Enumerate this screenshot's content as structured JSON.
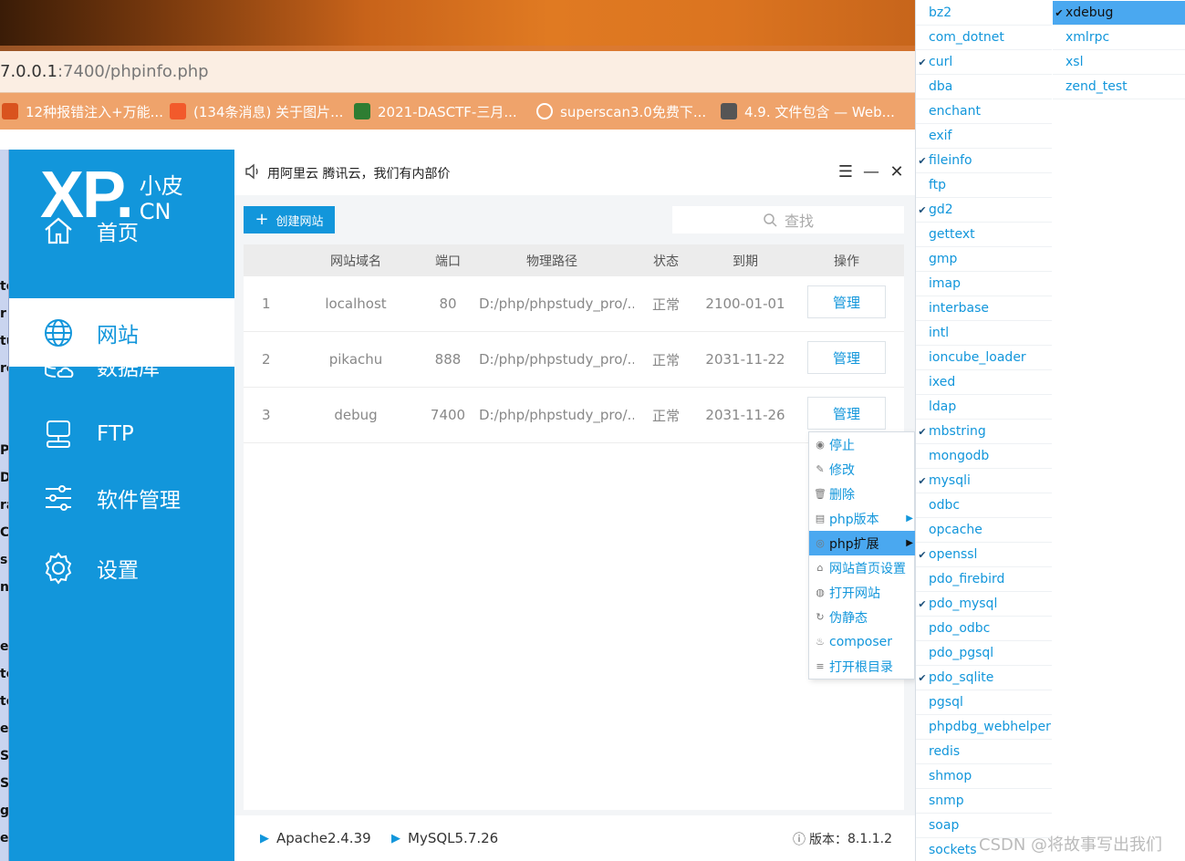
{
  "browser": {
    "address_main": "7.0.0.1",
    "address_rest": ":7400/phpinfo.php",
    "bookmarks": [
      {
        "label": "12种报错注入+万能...",
        "color": "#d9531e"
      },
      {
        "label": "(134条消息) 关于图片...",
        "color": "#f25a2b"
      },
      {
        "label": "2021-DASCTF-三月...",
        "color": "#2e7d32"
      },
      {
        "label": "superscan3.0免费下...",
        "color": "#ffffff"
      },
      {
        "label": "4.9. 文件包含 — Web...",
        "color": "#555555"
      }
    ]
  },
  "left_strip_chars": [
    "te",
    "r",
    "tu",
    "re",
    "P",
    "Di",
    "ra",
    "C",
    "s",
    "na",
    "er",
    "te",
    "te",
    "er",
    "Su",
    "Sa",
    "gn",
    "er"
  ],
  "sidebar": {
    "logo_big": "XP.",
    "logo_small_top": "小皮",
    "logo_small_bottom": "CN",
    "items": [
      {
        "label": "首页",
        "icon": "home-icon"
      },
      {
        "label": "网站",
        "icon": "globe-icon"
      },
      {
        "label": "数据库",
        "icon": "database-icon"
      },
      {
        "label": "FTP",
        "icon": "ftp-server-icon"
      },
      {
        "label": "软件管理",
        "icon": "sliders-icon"
      },
      {
        "label": "设置",
        "icon": "gear-icon"
      }
    ],
    "active_index": 1
  },
  "header": {
    "notice": "用阿里云 腾讯云，我们有内部价",
    "menu_glyph": "☰",
    "minimize_glyph": "—",
    "close_glyph": "✕"
  },
  "toolbar": {
    "create_plus": "+",
    "create_label": "创建网站",
    "search_icon": "search-icon",
    "search_label": "查找"
  },
  "table": {
    "columns": [
      "",
      "网站域名",
      "端口",
      "物理路径",
      "状态",
      "到期",
      "操作"
    ],
    "rows": [
      {
        "index": "1",
        "domain": "localhost",
        "port": "80",
        "path": "D:/php/phpstudy_pro/...",
        "status": "正常",
        "expiry": "2100-01-01",
        "action": "管理"
      },
      {
        "index": "2",
        "domain": "pikachu",
        "port": "888",
        "path": "D:/php/phpstudy_pro/...",
        "status": "正常",
        "expiry": "2031-11-22",
        "action": "管理"
      },
      {
        "index": "3",
        "domain": "debug",
        "port": "7400",
        "path": "D:/php/phpstudy_pro/...",
        "status": "正常",
        "expiry": "2031-11-26",
        "action": "管理"
      }
    ]
  },
  "context_menu": [
    {
      "label": "停止",
      "icon": "stop-icon",
      "glyph": "◉"
    },
    {
      "label": "修改",
      "icon": "pencil-icon",
      "glyph": "✎"
    },
    {
      "label": "删除",
      "icon": "trash-icon",
      "glyph": "🗑"
    },
    {
      "label": "php版本",
      "icon": "php-version-icon",
      "glyph": "▤",
      "submenu": true
    },
    {
      "label": "php扩展",
      "icon": "php-extension-icon",
      "glyph": "◎",
      "submenu": true,
      "highlighted": true
    },
    {
      "label": "网站首页设置",
      "icon": "home-small-icon",
      "glyph": "⌂"
    },
    {
      "label": "打开网站",
      "icon": "globe-small-icon",
      "glyph": "◍"
    },
    {
      "label": "伪静态",
      "icon": "refresh-icon",
      "glyph": "↻"
    },
    {
      "label": "composer",
      "icon": "composer-icon",
      "glyph": "♨"
    },
    {
      "label": "打开根目录",
      "icon": "list-icon",
      "glyph": "≡"
    }
  ],
  "extensions_col1": [
    {
      "name": "bz2",
      "checked": false
    },
    {
      "name": "com_dotnet",
      "checked": false
    },
    {
      "name": "curl",
      "checked": true
    },
    {
      "name": "dba",
      "checked": false
    },
    {
      "name": "enchant",
      "checked": false
    },
    {
      "name": "exif",
      "checked": false
    },
    {
      "name": "fileinfo",
      "checked": true
    },
    {
      "name": "ftp",
      "checked": false
    },
    {
      "name": "gd2",
      "checked": true
    },
    {
      "name": "gettext",
      "checked": false
    },
    {
      "name": "gmp",
      "checked": false
    },
    {
      "name": "imap",
      "checked": false
    },
    {
      "name": "interbase",
      "checked": false
    },
    {
      "name": "intl",
      "checked": false
    },
    {
      "name": "ioncube_loader",
      "checked": false
    },
    {
      "name": "ixed",
      "checked": false
    },
    {
      "name": "ldap",
      "checked": false
    },
    {
      "name": "mbstring",
      "checked": true
    },
    {
      "name": "mongodb",
      "checked": false
    },
    {
      "name": "mysqli",
      "checked": true
    },
    {
      "name": "odbc",
      "checked": false
    },
    {
      "name": "opcache",
      "checked": false
    },
    {
      "name": "openssl",
      "checked": true
    },
    {
      "name": "pdo_firebird",
      "checked": false
    },
    {
      "name": "pdo_mysql",
      "checked": true
    },
    {
      "name": "pdo_odbc",
      "checked": false
    },
    {
      "name": "pdo_pgsql",
      "checked": false
    },
    {
      "name": "pdo_sqlite",
      "checked": true
    },
    {
      "name": "pgsql",
      "checked": false
    },
    {
      "name": "phpdbg_webhelper",
      "checked": false
    },
    {
      "name": "redis",
      "checked": false
    },
    {
      "name": "shmop",
      "checked": false
    },
    {
      "name": "snmp",
      "checked": false
    },
    {
      "name": "soap",
      "checked": false
    },
    {
      "name": "sockets",
      "checked": false
    }
  ],
  "extensions_col2": [
    {
      "name": "xdebug",
      "checked": true,
      "highlighted": true
    },
    {
      "name": "xmlrpc",
      "checked": false
    },
    {
      "name": "xsl",
      "checked": false
    },
    {
      "name": "zend_test",
      "checked": false
    }
  ],
  "check_glyph": "✔",
  "status_bar": {
    "apache": "Apache2.4.39",
    "mysql": "MySQL5.7.26",
    "version_label": "版本：",
    "version": "8.1.1.2",
    "triangle": "▶",
    "info_glyph": "ⓘ"
  },
  "watermark": "CSDN @将故事写出我们",
  "colors": {
    "primary": "#1296db",
    "highlight": "#4aa8f0"
  }
}
